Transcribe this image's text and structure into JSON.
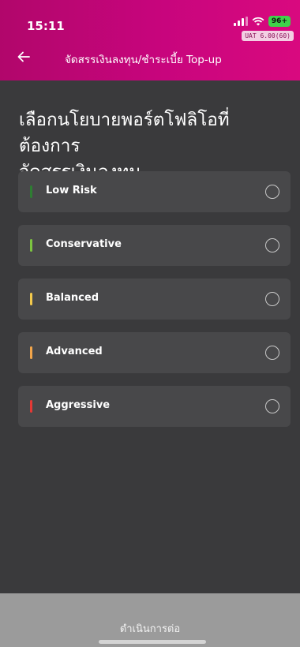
{
  "status_bar": {
    "time": "15:11",
    "battery": "96+",
    "env_badge": "UAT 6.00(60)"
  },
  "header": {
    "back_icon": "arrow-left-icon",
    "title": "จัดสรรเงินลงทุน/ชำระเบี้ย Top-up",
    "color": "#c8057d"
  },
  "page": {
    "title_line1": "เลือกนโยบายพอร์ตโฟลิโอที่ต้องการ",
    "title_line2": "จัดสรรเงินลงทุน"
  },
  "options": [
    {
      "label": "Low Risk",
      "color": "#2e7d32",
      "selected": false
    },
    {
      "label": "Conservative",
      "color": "#7cc440",
      "selected": false
    },
    {
      "label": "Balanced",
      "color": "#f2c94c",
      "selected": false
    },
    {
      "label": "Advanced",
      "color": "#f2a54a",
      "selected": false
    },
    {
      "label": "Aggressive",
      "color": "#e53935",
      "selected": false
    }
  ],
  "footer": {
    "continue_label": "ดำเนินการต่อ"
  }
}
